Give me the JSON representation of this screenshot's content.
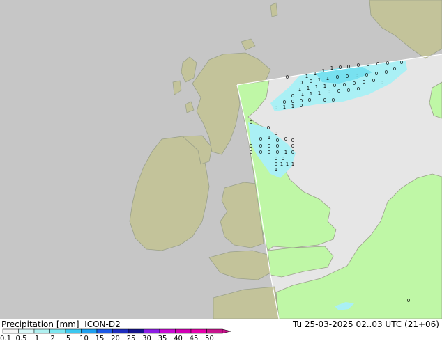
{
  "title": {
    "left": "Precipitation [mm]  ICON-D2",
    "right": "Tu 25-03-2025 02..03 UTC (21+06)"
  },
  "legend": {
    "ticks": [
      "0.1",
      "0.5",
      "1",
      "2",
      "5",
      "10",
      "15",
      "20",
      "25",
      "30",
      "35",
      "40",
      "45",
      "50"
    ],
    "colors": [
      "#f5f5f5",
      "#d8f8f8",
      "#b0f0f0",
      "#7de6f0",
      "#3cc8f0",
      "#1ea0f0",
      "#1e5ae6",
      "#1e2dbe",
      "#14148c",
      "#8c1ee6",
      "#c80ad2",
      "#d200b4",
      "#e600aa",
      "#c8148c"
    ]
  },
  "map": {
    "colors": {
      "sea": "#c6c6c6",
      "land_outside": "#c3c39a",
      "land_model": "#bff7a6",
      "sea_model": "#e6e6e6",
      "precip_light": "#aaf0f5",
      "precip_mid": "#78e1f0",
      "coast": "#9aa08a"
    },
    "markers": [
      "0",
      "1",
      "1",
      "1",
      "1",
      "0",
      "0",
      "0",
      "0",
      "0",
      "0",
      "0",
      "0",
      "1",
      "1",
      "0",
      "0",
      "0",
      "0",
      "0",
      "0",
      "1",
      "1",
      "1",
      "1",
      "0",
      "0",
      "0",
      "0",
      "0",
      "0",
      "1",
      "1",
      "1",
      "0",
      "0",
      "0",
      "0",
      "0",
      "0",
      "0",
      "0",
      "0",
      "0",
      "0",
      "1",
      "1",
      "0",
      "0",
      "0",
      "0",
      "0",
      "0",
      "0",
      "0",
      "1",
      "0",
      "0",
      "0",
      "0",
      "0",
      "0",
      "0",
      "0",
      "0",
      "0",
      "0",
      "0",
      "1",
      "0",
      "0",
      "0",
      "0",
      "1",
      "1",
      "1",
      "1",
      "0"
    ]
  }
}
